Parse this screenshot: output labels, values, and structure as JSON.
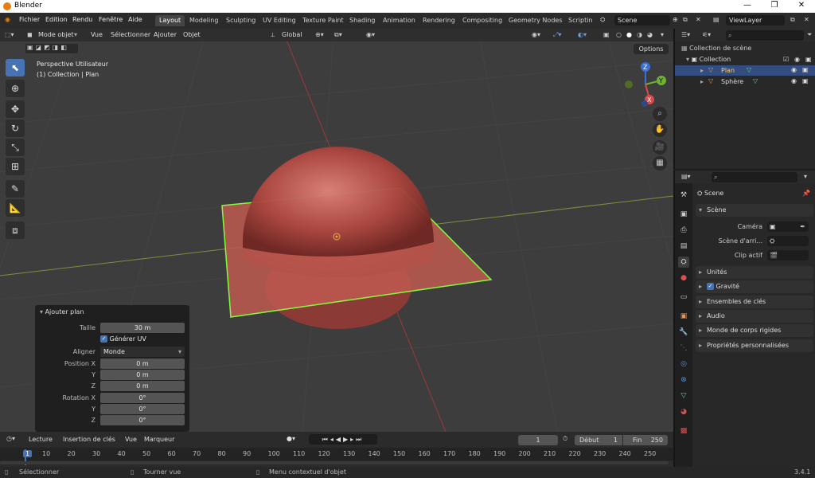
{
  "window": {
    "title": "Blender",
    "minimize": "—",
    "restore": "❐",
    "close": "✕"
  },
  "menu": [
    "Fichier",
    "Edition",
    "Rendu",
    "Fenêtre",
    "Aide"
  ],
  "workspaces": [
    "Layout",
    "Modeling",
    "Sculpting",
    "UV Editing",
    "Texture Paint",
    "Shading",
    "Animation",
    "Rendering",
    "Compositing",
    "Geometry Nodes",
    "Scripting"
  ],
  "active_workspace": "Layout",
  "scene_field": "Scene",
  "viewlayer_field": "ViewLayer",
  "viewport_header": {
    "mode": "Mode objet",
    "menus": [
      "Vue",
      "Sélectionner",
      "Ajouter",
      "Objet"
    ],
    "transform_orientation": "Global",
    "options": "Options"
  },
  "viewport_overlay": {
    "view_name": "Perspective Utilisateur",
    "collection_info": "(1) Collection | Plan"
  },
  "gizmo": {
    "z": "Z",
    "y": "Y",
    "x": "X"
  },
  "redo_panel": {
    "title": "Ajouter plan",
    "size_label": "Taille",
    "size_value": "30 m",
    "gen_uv_label": "Générer UV",
    "align_label": "Aligner",
    "align_value": "Monde",
    "pos_label": "Position X",
    "pos_x": "0 m",
    "pos_y": "0 m",
    "pos_z": "0 m",
    "rot_label": "Rotation X",
    "rot_x": "0°",
    "rot_y": "0°",
    "rot_z": "0°",
    "y_label": "Y",
    "z_label": "Z"
  },
  "timeline": {
    "menus": [
      "Lecture",
      "Insertion de clés",
      "Vue",
      "Marqueur"
    ],
    "current_frame": "1",
    "start_label": "Début",
    "start_value": "1",
    "end_label": "Fin",
    "end_value": "250",
    "ticks": [
      "1",
      "10",
      "20",
      "30",
      "40",
      "50",
      "60",
      "70",
      "80",
      "90",
      "100",
      "110",
      "120",
      "130",
      "140",
      "150",
      "160",
      "170",
      "180",
      "190",
      "200",
      "210",
      "220",
      "230",
      "240",
      "250"
    ]
  },
  "outliner": {
    "root": "Collection de scène",
    "collection": "Collection",
    "items": [
      "Plan",
      "Sphère"
    ]
  },
  "properties": {
    "context": "Scene",
    "section_scene": "Scène",
    "camera_label": "Caméra",
    "bg_scene_label": "Scène d'arri...",
    "clip_label": "Clip actif",
    "sections": [
      "Unités",
      "Gravité",
      "Ensembles de clés",
      "Audio",
      "Monde de corps rigides",
      "Propriétés personnalisées"
    ]
  },
  "status": {
    "select": "Sélectionner",
    "rotate": "Tourner vue",
    "context_menu": "Menu contextuel d'objet",
    "version": "3.4.1"
  },
  "colors": {
    "accent": "#4772b3",
    "selection": "#7fff3a",
    "mesh": "#b0524c"
  }
}
